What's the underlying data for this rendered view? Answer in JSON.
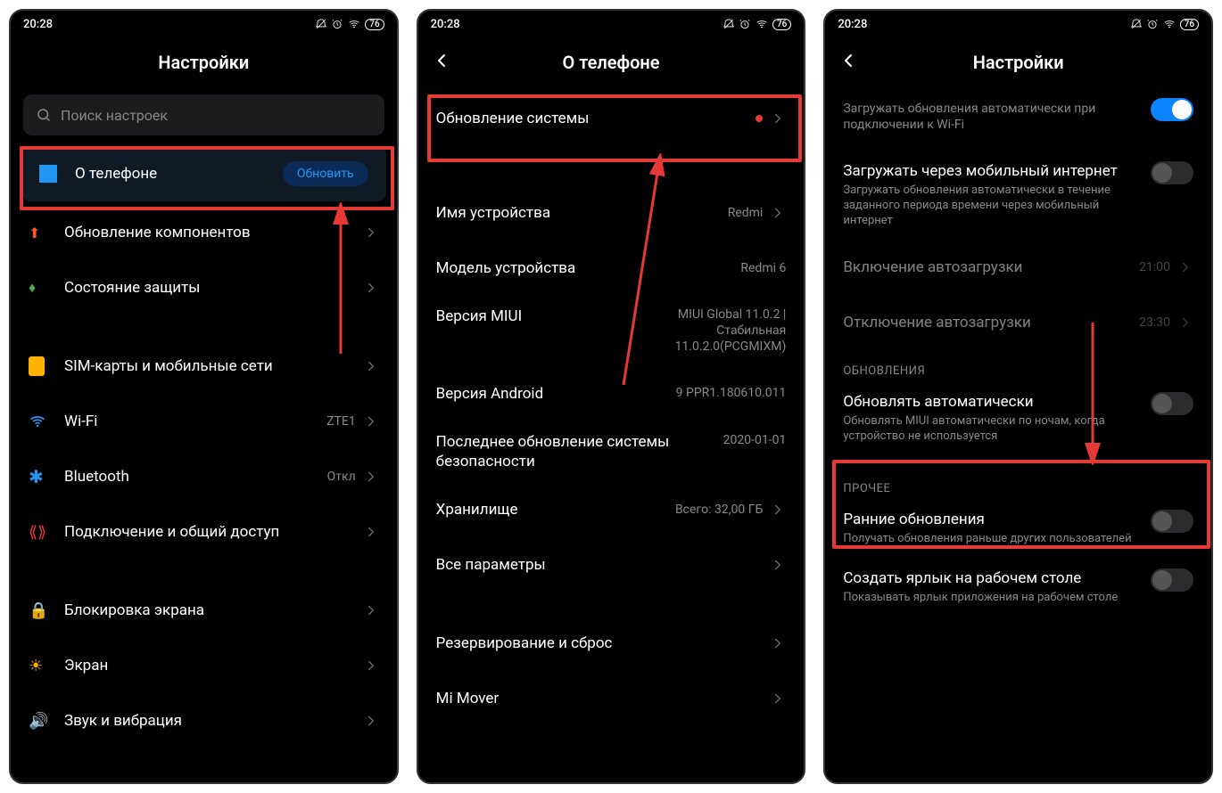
{
  "status": {
    "time": "20:28",
    "battery": "76"
  },
  "screen1": {
    "title": "Настройки",
    "search_placeholder": "Поиск настроек",
    "about": {
      "label": "О телефоне",
      "badge": "Обновить"
    },
    "items": [
      {
        "label": "Обновление компонентов"
      },
      {
        "label": "Состояние защиты"
      }
    ],
    "group2": [
      {
        "label": "SIM-карты и мобильные сети"
      },
      {
        "label": "Wi-Fi",
        "value": "ZTE1"
      },
      {
        "label": "Bluetooth",
        "value": "Откл"
      },
      {
        "label": "Подключение и общий доступ"
      }
    ],
    "group3": [
      {
        "label": "Блокировка экрана"
      },
      {
        "label": "Экран"
      },
      {
        "label": "Звук и вибрация"
      }
    ]
  },
  "screen2": {
    "title": "О телефоне",
    "system_update": "Обновление системы",
    "rows": [
      {
        "label": "Имя устройства",
        "value": "Redmi"
      },
      {
        "label": "Модель устройства",
        "value": "Redmi 6"
      },
      {
        "label": "Версия MIUI",
        "value": "MIUI Global 11.0.2 | Стабильная 11.0.2.0(PCGMIXM)"
      },
      {
        "label": "Версия Android",
        "value": "9 PPR1.180610.011"
      },
      {
        "label": "Последнее обновление системы безопасности",
        "value": "2020-01-01"
      },
      {
        "label": "Хранилище",
        "value": "Всего: 32,00 ГБ"
      },
      {
        "label": "Все параметры"
      }
    ],
    "bottom": [
      {
        "label": "Резервирование и сброс"
      },
      {
        "label": "Mi Mover"
      }
    ]
  },
  "screen3": {
    "title": "Настройки",
    "wifi": {
      "label": "Загружать обновления автоматически при подключении к Wi-Fi",
      "on": true
    },
    "mobile": {
      "label": "Загружать через мобильный интернет",
      "sub": "Загружать обновления автоматически в течение заданного периода времени через мобильный интернет"
    },
    "times": [
      {
        "label": "Включение автозагрузки",
        "value": "21:00"
      },
      {
        "label": "Отключение автозагрузки",
        "value": "23:30"
      }
    ],
    "section_updates": "ОБНОВЛЕНИЯ",
    "auto": {
      "label": "Обновлять автоматически",
      "sub": "Обновлять MIUI автоматически по ночам, когда устройство не используется"
    },
    "section_other": "ПРОЧЕЕ",
    "early": {
      "label": "Ранние обновления",
      "sub": "Получать обновления раньше других пользователей"
    },
    "shortcut": {
      "label": "Создать ярлык на рабочем столе",
      "sub": "Показывать ярлык приложения на рабочем столе"
    }
  }
}
